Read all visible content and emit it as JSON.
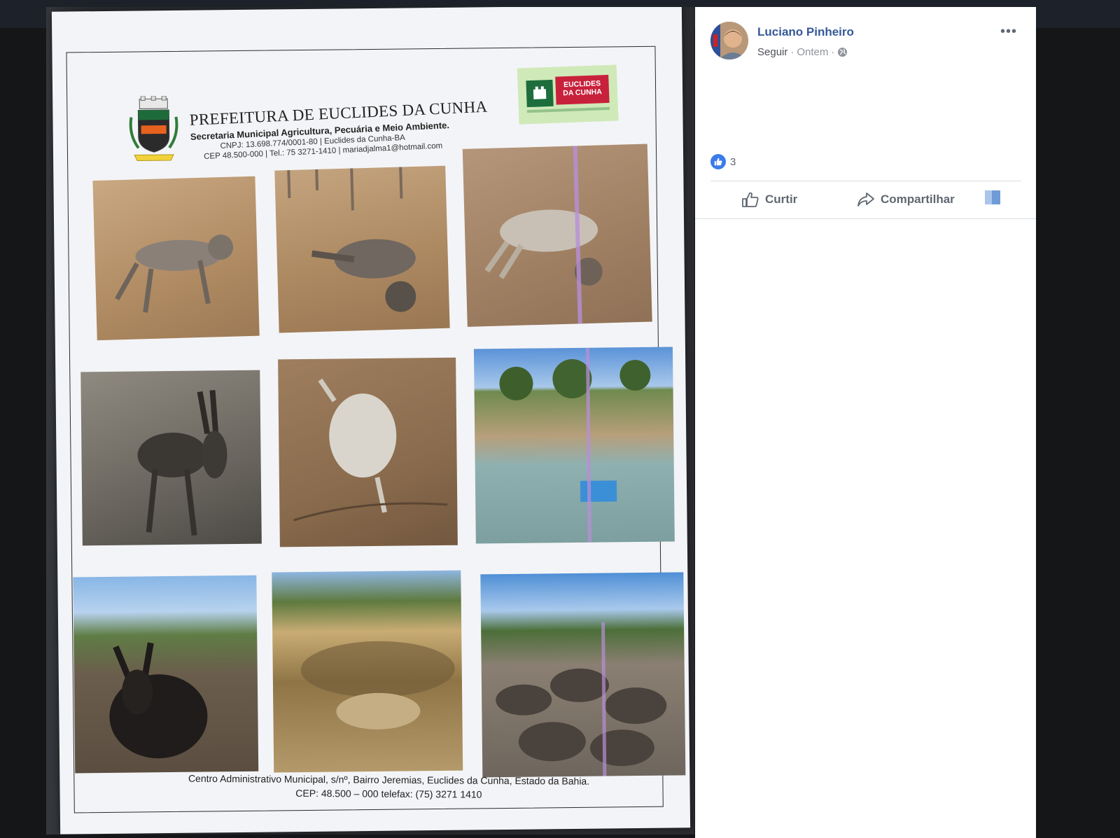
{
  "document": {
    "title": "PREFEITURA DE EUCLIDES DA CUNHA",
    "subtitle": "Secretaria Municipal Agricultura, Pecuária e Meio Ambiente.",
    "cnpj_line": "CNPJ: 13.698.774/0001-80 | Euclides da Cunha-BA",
    "contact_line": "CEP 48.500-000 | Tel.: 75 3271-1410 | mariadjalma1@hotmail.com",
    "logo_text_1": "EUCLIDES",
    "logo_text_2": "DA CUNHA",
    "footer_line_1": "Centro Administrativo Municipal, s/nº, Bairro Jeremias, Euclides da Cunha, Estado da Bahia.",
    "footer_line_2": "CEP: 48.500 – 000 telefax: (75) 3271 1410"
  },
  "post": {
    "author": "Luciano Pinheiro",
    "follow_label": "Seguir",
    "separator": "·",
    "time": "Ontem",
    "reaction_count": "3",
    "like_label": "Curtir",
    "share_label": "Compartilhar"
  },
  "icons": {
    "more": "more-options-icon",
    "globe": "globe-icon",
    "like": "thumbs-up-icon",
    "share": "share-arrow-icon"
  },
  "colors": {
    "facebook_link": "#365899",
    "like_badge": "#3b7bea",
    "muted_text": "#90949c"
  }
}
